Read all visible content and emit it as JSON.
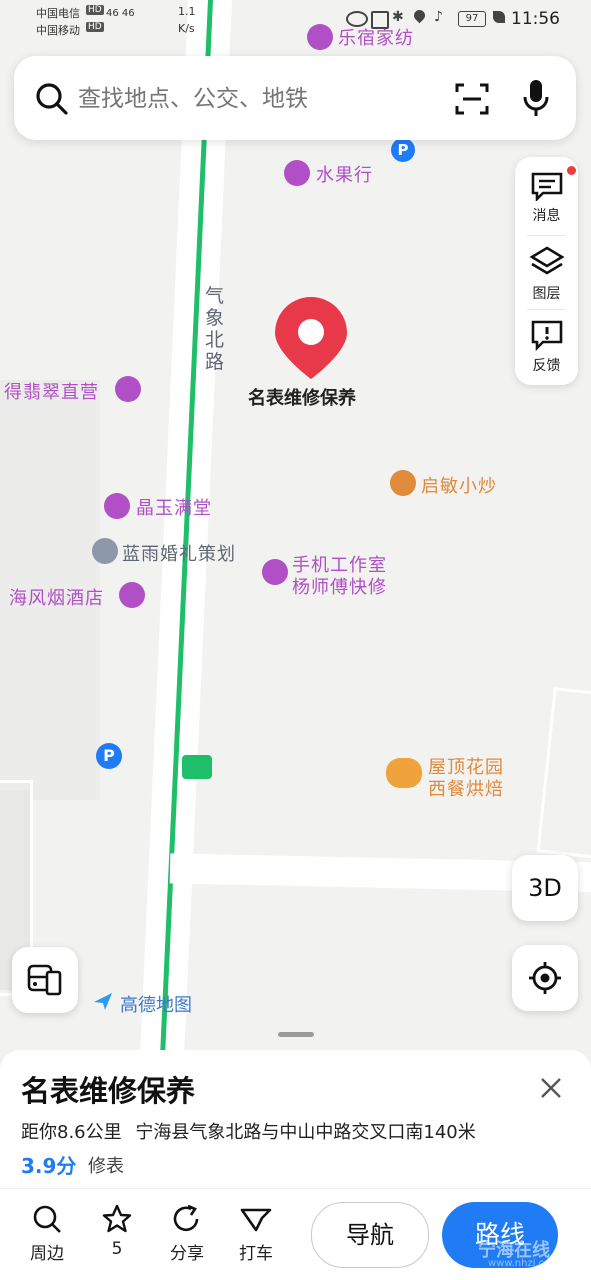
{
  "status_bar": {
    "carrier1": "中国电信",
    "carrier2": "中国移动",
    "hd1": "HD",
    "hd2": "HD",
    "signal_text": "46  46",
    "speed_value": "1.1",
    "speed_unit": "K/s",
    "battery": "97",
    "time": "11:56"
  },
  "search": {
    "placeholder": "查找地点、公交、地铁"
  },
  "tools": {
    "messages": "消息",
    "layers": "图层",
    "feedback": "反馈"
  },
  "map": {
    "road_name": "气象北路",
    "selected_place": "名表维修保养",
    "pois": [
      {
        "name": "乐宿家纺"
      },
      {
        "name": "水果行"
      },
      {
        "name": "得翡翠直营"
      },
      {
        "name": "启敏小炒"
      },
      {
        "name": "晶玉满堂"
      },
      {
        "name": "蓝雨婚礼策划"
      },
      {
        "name": "手机工作室"
      },
      {
        "name": "杨师傅快修"
      },
      {
        "name": "海风烟酒店"
      },
      {
        "name": "屋顶花园"
      },
      {
        "name": "西餐烘焙"
      }
    ],
    "btn_3d": "3D",
    "logo_text": "高德地图"
  },
  "sheet": {
    "title": "名表维修保养",
    "distance": "距你8.6公里",
    "address": "宁海县气象北路与中山中路交叉口南140米",
    "rating": "3.9分",
    "category": "修表",
    "actions": [
      {
        "label": "周边"
      },
      {
        "label": "5"
      },
      {
        "label": "分享"
      },
      {
        "label": "打车"
      }
    ],
    "navigate": "导航",
    "route": "路线",
    "watermark": "宁海在线",
    "watermark_url": "www.nhzj.com"
  },
  "colors": {
    "brand_blue": "#1f7cf5",
    "poi_purple": "#b14fc6",
    "poi_orange": "#e08a3b",
    "bus_green": "#1fbf6a",
    "pin_red": "#e8394a"
  }
}
